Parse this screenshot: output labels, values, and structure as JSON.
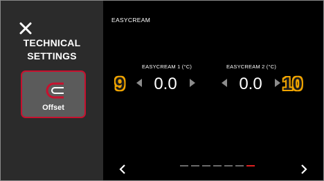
{
  "sidebar": {
    "title": "TECHNICAL\nSETTINGS",
    "tile_label": "Offset",
    "accent": "#c8102e"
  },
  "main": {
    "title": "EASYCREAM",
    "params": [
      {
        "label": "EASYCREAM 1 (°C)",
        "value": "0.0"
      },
      {
        "label": "EASYCREAM 2 (°C)",
        "value": "0.0"
      }
    ],
    "badges": [
      "9",
      "10"
    ],
    "pager": {
      "count": 7,
      "active": 7
    }
  },
  "icons": {
    "close": "close-icon",
    "offset": "offset-icon",
    "left": "chevron-left-icon",
    "right": "chevron-right-icon"
  }
}
